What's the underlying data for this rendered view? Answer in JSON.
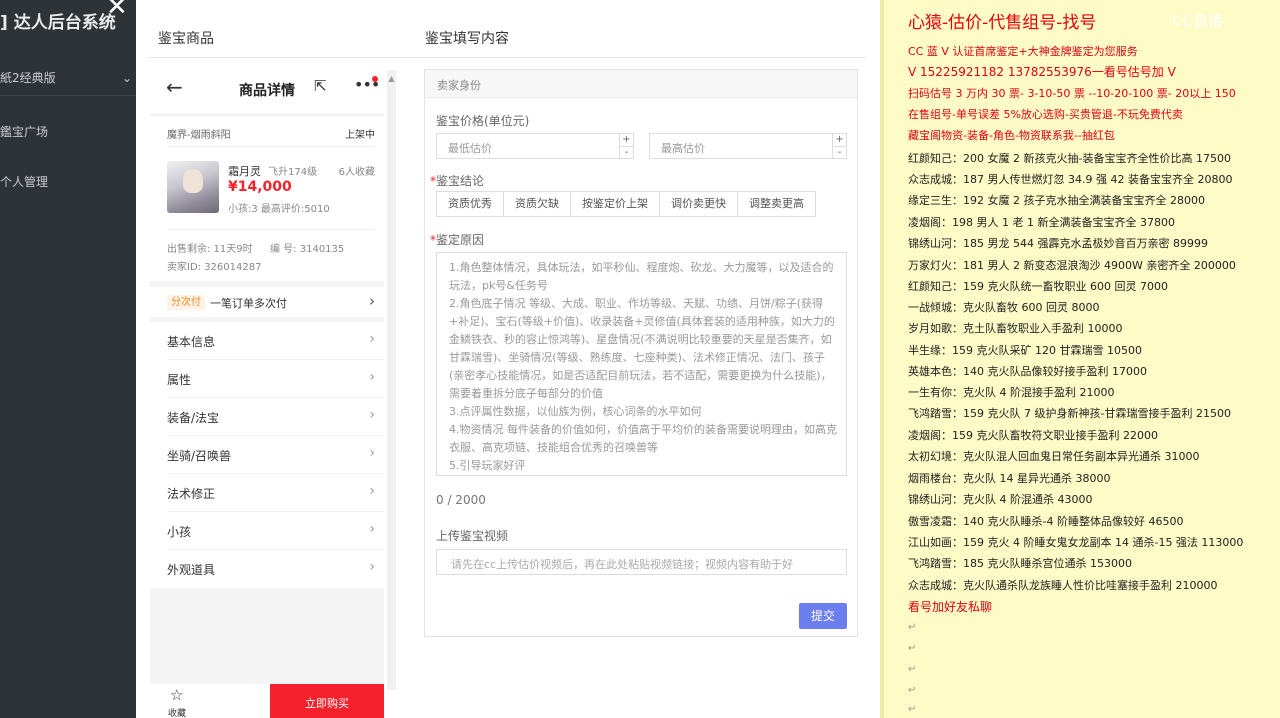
{
  "sidebar": {
    "brand": "] 达人后台系统",
    "version": "紙2经典版",
    "version_chevron": "⌄",
    "menu": [
      "鑑宝广场",
      "个人管理"
    ]
  },
  "modal": {
    "close": "✕",
    "left_title": "鉴宝商品",
    "right_title": "鉴宝填写内容"
  },
  "product": {
    "back_icon": "←",
    "title": "商品详情",
    "share_icon": "⇱",
    "more_icon": "•••",
    "server": "魔界-烟雨斜阳",
    "status": "上架中",
    "name": "霜月灵",
    "level": "飞升174级",
    "favorites": "6人收藏",
    "price": "¥14,000",
    "kids": "小孩:3 最高评价:5010",
    "remaining": "出售剩余: 11天9时",
    "number": "编 号: 3140135",
    "seller": "卖家ID: 326014287",
    "installment_tag": "分次付",
    "installment_text": "一笔订单多次付",
    "arrow": "›",
    "sections": [
      "基本信息",
      "属性",
      "装备/法宝",
      "坐骑/召唤兽",
      "法术修正",
      "小孩",
      "外观道具"
    ],
    "fav_label": "收藏",
    "fav_icon": "☆",
    "buy_label": "立即购买"
  },
  "form": {
    "section": "卖家身份",
    "price_label": "鉴宝价格(单位元)",
    "min_placeholder": "最低估价",
    "max_placeholder": "最高估价",
    "plus": "+",
    "minus": "-",
    "conclusion_label": "鉴宝结论",
    "required_mark": "*",
    "conclusions": [
      "资质优秀",
      "资质欠缺",
      "按鉴定价上架",
      "调价卖更快",
      "调整卖更高"
    ],
    "reason_label": "鉴定原因",
    "reason_lines": [
      "1.角色整体情况，具体玩法，如平秒仙、程度炮、砍龙、大力魔等，以及适合的玩法，pk号&任务号",
      "2.角色底子情况 等级、大成、职业、作坊等级、天赋、功绩、月饼/粽子(获得+补足)、宝石(等级+价值)、收录装备+灵修值(具体套装的适用种族，如大力的金鳞铁衣、秒的容止惊鸿等)、星盘情况(不满说明比较重要的天星是否集齐，如甘霖瑞雪)、坐骑情况(等级、熟练度、七座种类)、法术修正情况、法门、孩子(亲密孝心技能情况，如是否适配目前玩法，若不适配，需要更换为什么技能)，需要着重拆分底子每部分的价值",
      "3.点评属性数据，以仙族为例，核心词条的水平如何",
      "4.物资情况 每件装备的价值如何，价值高于平均价的装备需要说明理由，如高克衣服、高克项链、技能组合优秀的召唤兽等",
      "5.引导玩家好评"
    ],
    "counter": "0 / 2000",
    "video_label": "上传鉴宝视频",
    "video_placeholder": "请先在cc上传估价视频后，再在此处粘贴视频链接；视频内容有助于好",
    "submit": "提交"
  },
  "note": {
    "watermark": "CC直播",
    "title": "心猿-估价-代售组号-找号",
    "red_lines": [
      "CC 蓝 V 认证首席鉴定+大神金牌鉴定为您服务",
      "V 15225921182      13782553976一看号估号加 V",
      "扫码估号 3 万内 30 票- 3-10-50 票  --10-20-100 票- 20以上 150",
      "在售组号-单号误差 5%放心选购-买贵管退-不玩免费代卖",
      "藏宝阁物资-装备-角色-物资联系我--抽红包"
    ],
    "black_lines": [
      "红颜知己：200 女魔 2 新孩克火抽-装备宝宝齐全性价比高 17500",
      "众志成城：187 男人传世燃灯忽 34.9 强 42 装备宝宝齐全 20800",
      "缘定三生：192 女魔 2 孩子克水抽全满装备宝宝齐全 28000",
      "凌烟阁：198 男人 1 老 1 新全满装备宝宝齐全 37800",
      "锦绣山河：185 男龙 544 强霹克水孟极妙音百万亲密 89999",
      "万家灯火：181 男人 2 新变态混浪淘沙 4900W 亲密齐全 200000",
      "红颜知己：159 克火队统一畜牧职业 600 回灵 7000",
      "一战倾城：克火队畜牧 600 回灵 8000",
      "岁月如歌：克土队畜牧职业入手盈利 10000",
      "半生缘：159 克火队采矿 120 甘霖瑞雪 10500",
      "英雄本色：140 克火队品像较好接手盈利 17000",
      "一生有你：克火队 4 阶混接手盈利 21000",
      "飞鸿踏雪：159 克火队 7 级护身新神孩-甘霖瑞雪接手盈利 21500",
      "凌烟阁：159 克火队畜牧符文职业接手盈利 22000",
      "太初幻境：克火队混人回血鬼日常任务副本异光通杀 31000",
      "烟雨楼台：克火队 14 星异光通杀 38000",
      "锦绣山河：克火队 4 阶混通杀 43000",
      "傲雪凌霜：140 克火队睡杀-4 阶睡整体品像较好 46500",
      "江山如画：159 克火 4 阶睡女鬼女龙副本 14 通杀-15 强法 113000",
      "飞鸿踏雪：185 克火队睡杀宫位通杀 153000",
      "众志成城：克火队通杀队龙族睡人性价比哇塞接手盈利 210000"
    ],
    "footer_line": "看号加好友私聊",
    "para_mark": "↵"
  }
}
